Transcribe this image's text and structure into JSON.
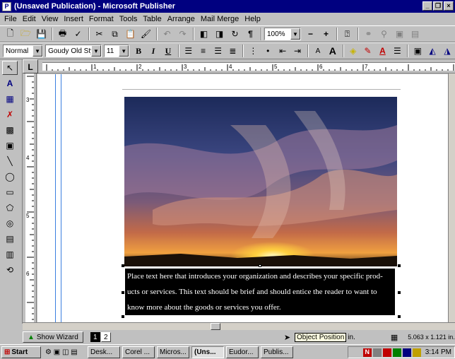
{
  "window": {
    "title": "(Unsaved Publication) - Microsoft Publisher",
    "app_icon": "publisher-icon"
  },
  "menu": [
    "File",
    "Edit",
    "View",
    "Insert",
    "Format",
    "Tools",
    "Table",
    "Arrange",
    "Mail Merge",
    "Help"
  ],
  "toolbar": {
    "zoom": "100%"
  },
  "format_bar": {
    "style": "Normal",
    "font": "Goudy Old Style",
    "size": "11"
  },
  "document": {
    "text": "Place text here that introduces your organization and describes your specific prod-ucts or services. This text should be brief and should entice the reader to want to know more about the goods or services you offer.",
    "text_lines": [
      "Place text here that introduces your organization and describes your specific prod-",
      "ucts or services. This text should be brief and should entice the reader to want to",
      "know more about the goods or services you offer."
    ]
  },
  "ruler": {
    "h_labels": [
      "1",
      "2",
      "3",
      "4",
      "5",
      "6",
      "7"
    ],
    "v_labels": [
      "3",
      "4",
      "5",
      "6"
    ]
  },
  "status": {
    "show_wizard": "Show Wizard",
    "pages": [
      "1",
      "2"
    ],
    "tooltip": "Object Position",
    "position_unit": "in.",
    "size": "5.063 x 1.121 in."
  },
  "taskbar": {
    "start": "Start",
    "tasks": [
      "Desk...",
      "Corel ...",
      "Micros...",
      "(Uns...",
      "Eudor...",
      "Publis..."
    ],
    "clock": "3:14 PM"
  }
}
